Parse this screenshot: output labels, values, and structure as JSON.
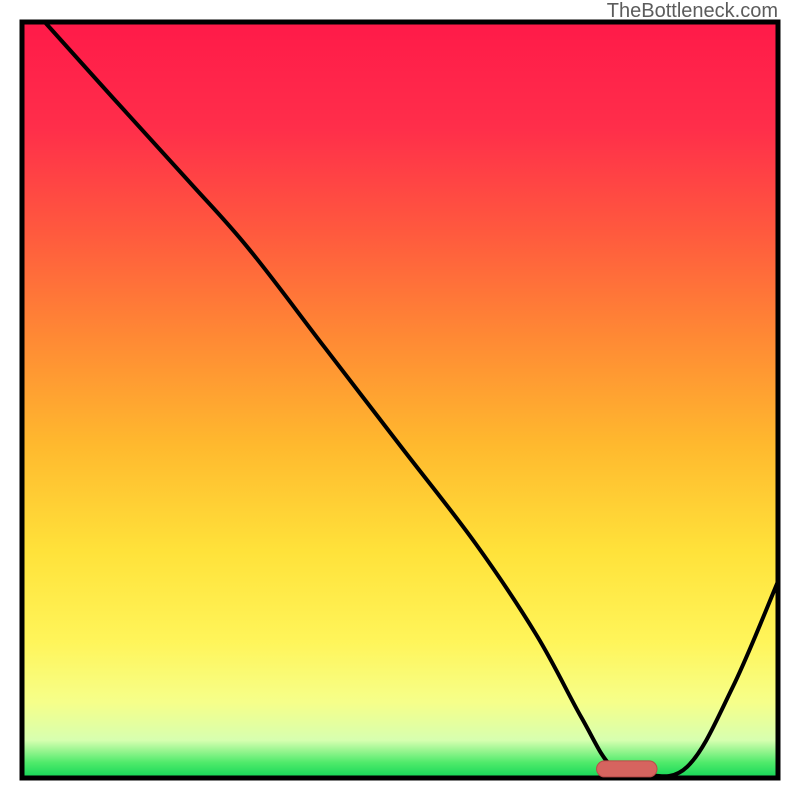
{
  "branding": "TheBottleneck.com",
  "colors": {
    "border": "#000000",
    "curve": "#000000",
    "marker_fill": "#d6645f",
    "marker_stroke": "#bb4a49"
  },
  "chart_data": {
    "type": "line",
    "title": "",
    "xlabel": "",
    "ylabel": "",
    "xlim": [
      0,
      100
    ],
    "ylim": [
      0,
      100
    ],
    "series": [
      {
        "name": "bottleneck-curve",
        "x": [
          3,
          12,
          22,
          30,
          40,
          50,
          60,
          68,
          74,
          78,
          82,
          88,
          94,
          100
        ],
        "y": [
          100,
          90,
          79,
          70,
          57,
          44,
          31,
          19,
          8,
          1.5,
          0.5,
          1.5,
          12,
          26
        ]
      }
    ],
    "marker": {
      "name": "optimal-range",
      "x_start": 76,
      "x_end": 84,
      "y": 1.2,
      "shape": "pill"
    },
    "grid": false,
    "legend": false
  }
}
